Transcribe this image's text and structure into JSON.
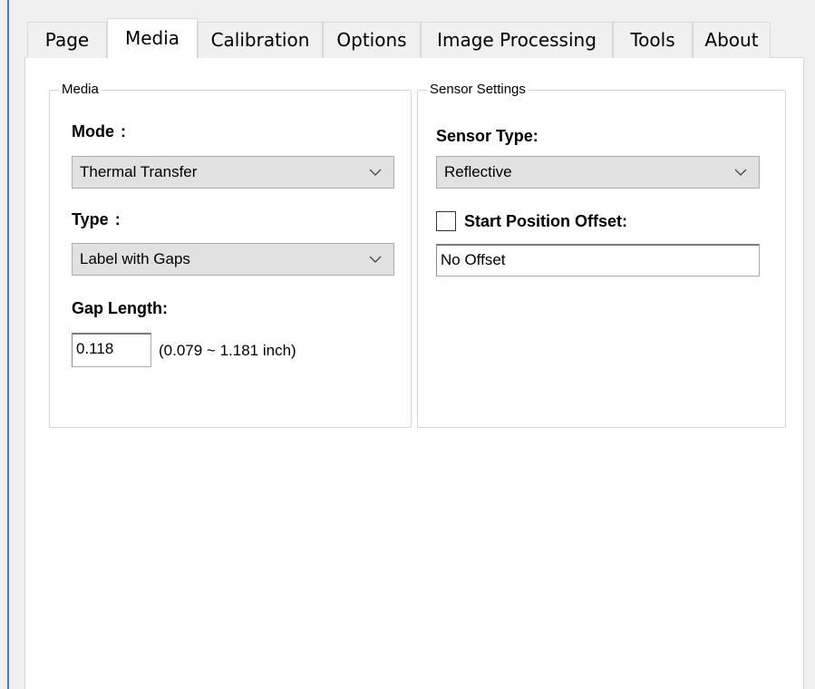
{
  "tabs": [
    {
      "label": "Page",
      "active": false
    },
    {
      "label": "Media",
      "active": true
    },
    {
      "label": "Calibration",
      "active": false
    },
    {
      "label": "Options",
      "active": false
    },
    {
      "label": "Image Processing",
      "active": false
    },
    {
      "label": "Tools",
      "active": false
    },
    {
      "label": "About",
      "active": false
    }
  ],
  "media_group": {
    "title": "Media",
    "mode_label": "Mode",
    "mode_colon": ":",
    "mode_value": "Thermal Transfer",
    "type_label": "Type",
    "type_colon": ":",
    "type_value": "Label with Gaps",
    "gap_label": "Gap Length:",
    "gap_value": "0.118",
    "gap_range": "(0.079 ~ 1.181 inch)"
  },
  "sensor_group": {
    "title": "Sensor Settings",
    "sensor_type_label": "Sensor Type:",
    "sensor_type_value": "Reflective",
    "start_offset_label": "Start Position Offset:",
    "start_offset_checked": false,
    "start_offset_value": "No Offset"
  },
  "colors": {
    "window_bg": "#f0f0f0",
    "page_bg": "#ffffff",
    "combo_bg": "#e1e1e1",
    "accent_edge": "#3c7fc4"
  }
}
